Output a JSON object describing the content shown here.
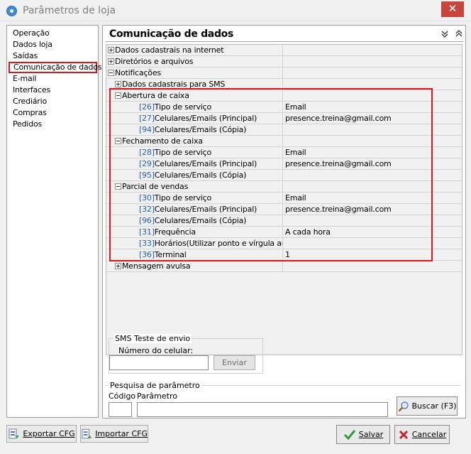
{
  "window": {
    "title": "Parâmetros de loja",
    "close": "✕"
  },
  "nav": {
    "items": [
      "Operação",
      "Dados loja",
      "Saídas",
      "Comunicação de dados",
      "E-mail",
      "Interfaces",
      "Crediário",
      "Compras",
      "Pedidos"
    ],
    "active_index": 3
  },
  "section": {
    "title": "Comunicação de dados"
  },
  "grid": {
    "rows": [
      {
        "indent": 0,
        "expander": "plus",
        "code": "",
        "name": "Dados cadastrais na internet",
        "value": ""
      },
      {
        "indent": 0,
        "expander": "plus",
        "code": "",
        "name": "Diretórios e arquivos",
        "value": ""
      },
      {
        "indent": 0,
        "expander": "minus",
        "code": "",
        "name": "Notificações",
        "value": ""
      },
      {
        "indent": 1,
        "expander": "plus",
        "code": "",
        "name": "Dados cadastrais para SMS",
        "value": ""
      },
      {
        "indent": 1,
        "expander": "minus",
        "code": "",
        "name": "Abertura de caixa",
        "value": ""
      },
      {
        "indent": 2,
        "expander": "",
        "code": "[26]",
        "name": "Tipo de serviço",
        "value": "Email"
      },
      {
        "indent": 2,
        "expander": "",
        "code": "[27]",
        "name": "Celulares/Emails (Principal)",
        "value": "presence.treina@gmail.com"
      },
      {
        "indent": 2,
        "expander": "",
        "code": "[94]",
        "name": "Celulares/Emails (Cópia)",
        "value": ""
      },
      {
        "indent": 1,
        "expander": "minus",
        "code": "",
        "name": "Fechamento de caixa",
        "value": ""
      },
      {
        "indent": 2,
        "expander": "",
        "code": "[28]",
        "name": "Tipo de serviço",
        "value": "Email"
      },
      {
        "indent": 2,
        "expander": "",
        "code": "[29]",
        "name": "Celulares/Emails (Principal)",
        "value": "presence.treina@gmail.com"
      },
      {
        "indent": 2,
        "expander": "",
        "code": "[95]",
        "name": "Celulares/Emails (Cópia)",
        "value": ""
      },
      {
        "indent": 1,
        "expander": "minus",
        "code": "",
        "name": "Parcial de vendas",
        "value": ""
      },
      {
        "indent": 2,
        "expander": "",
        "code": "[30]",
        "name": "Tipo de serviço",
        "value": "Email"
      },
      {
        "indent": 2,
        "expander": "",
        "code": "[32]",
        "name": "Celulares/Emails (Principal)",
        "value": "presence.treina@gmail.com"
      },
      {
        "indent": 2,
        "expander": "",
        "code": "[96]",
        "name": "Celulares/Emails (Cópia)",
        "value": ""
      },
      {
        "indent": 2,
        "expander": "",
        "code": "[31]",
        "name": "Frequência",
        "value": "A cada hora"
      },
      {
        "indent": 2,
        "expander": "",
        "code": "[33]",
        "name": "Horários(Utilizar ponto e vírgula ao final)",
        "value": ""
      },
      {
        "indent": 2,
        "expander": "",
        "code": "[36]",
        "name": "Terminal",
        "value": "1"
      },
      {
        "indent": 1,
        "expander": "plus",
        "code": "",
        "name": "Mensagem avulsa",
        "value": ""
      }
    ]
  },
  "sms_test": {
    "legend": "SMS Teste de envio",
    "phone_label": "Número do celular:",
    "phone_value": "",
    "send_label": "Enviar"
  },
  "search": {
    "legend": "Pesquisa de parâmetro",
    "code_label": "Código",
    "param_label": "Parâmetro",
    "code_value": "",
    "param_value": "",
    "button_label": "Buscar (F3)"
  },
  "footer": {
    "export_label": "Exportar CFG",
    "import_label": "Importar CFG",
    "save_label": "Salvar",
    "cancel_label": "Cancelar"
  },
  "colors": {
    "highlight": "#e0161d",
    "code": "#2a5fb3",
    "save": "#2e9e3a",
    "cancel": "#c8232c"
  }
}
